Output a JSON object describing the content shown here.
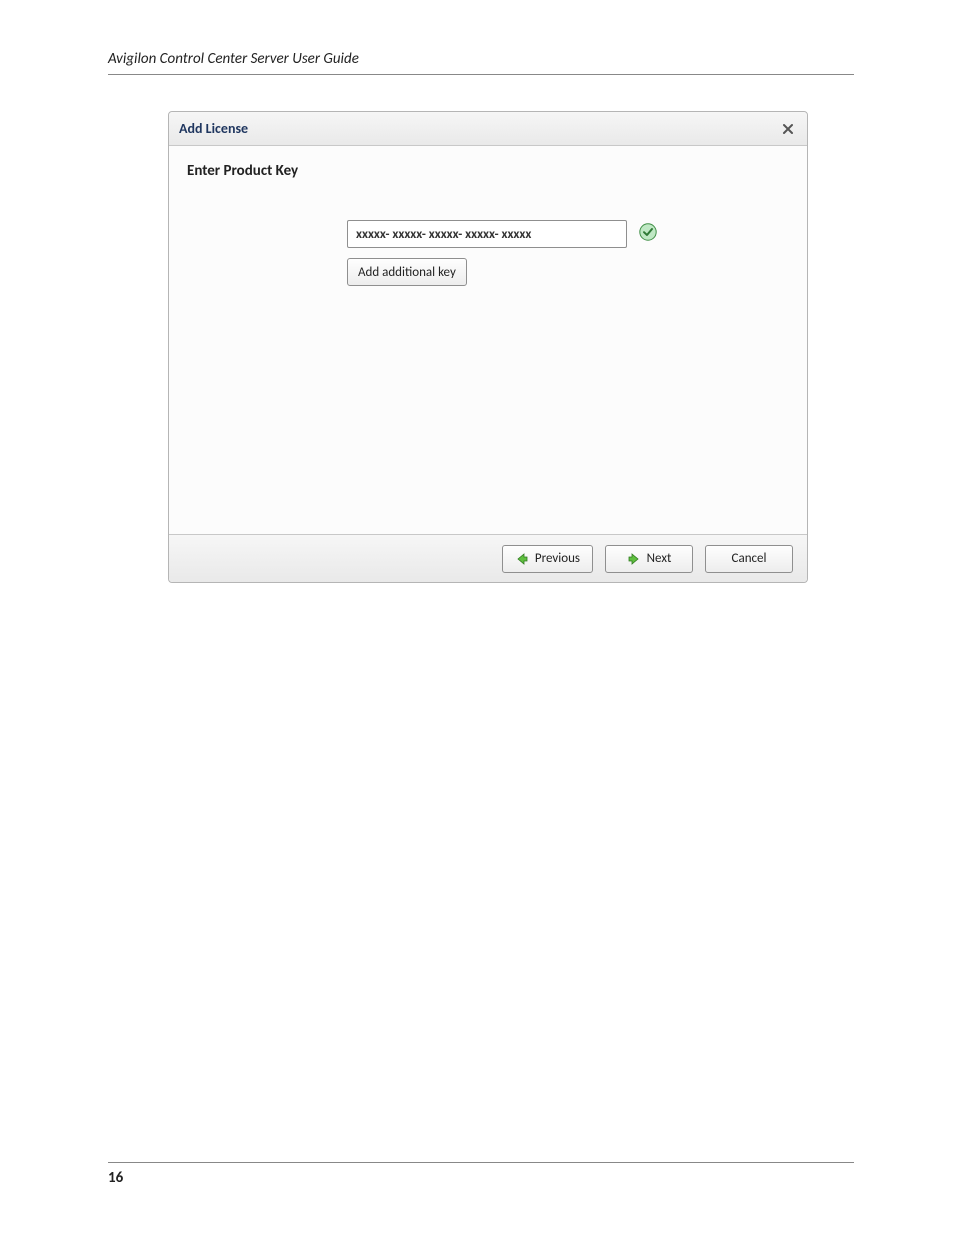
{
  "doc": {
    "header_title": "Avigilon Control Center Server User Guide",
    "page_number": "16"
  },
  "dialog": {
    "title": "Add License",
    "section_heading": "Enter Product Key",
    "product_key_value": "xxxxx- xxxxx- xxxxx- xxxxx- xxxxx",
    "add_key_label": "Add additional key",
    "footer": {
      "previous_label": "Previous",
      "next_label": "Next",
      "cancel_label": "Cancel"
    }
  }
}
